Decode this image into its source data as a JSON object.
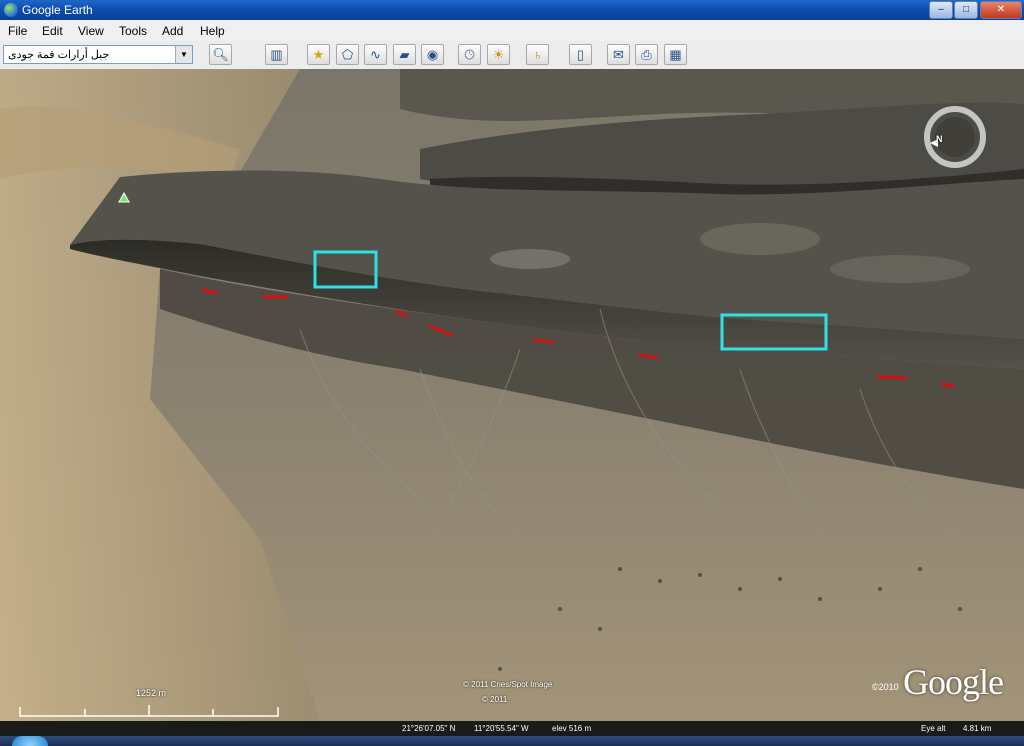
{
  "window": {
    "title": "Google Earth",
    "controls": {
      "minimize": "–",
      "maximize": "□",
      "close": "✕"
    }
  },
  "menu": [
    "File",
    "Edit",
    "View",
    "Tools",
    "Add",
    "Help"
  ],
  "search": {
    "value": "جبل أرارات قمة جودى"
  },
  "toolbar": {
    "buttons": [
      "search-icon",
      "sidebar-icon",
      "placemark-icon",
      "polygon-icon",
      "path-icon",
      "overlay-icon",
      "tour-icon",
      "history-icon",
      "sunlight-icon",
      "planet-icon",
      "ruler-icon",
      "email-icon",
      "print-icon",
      "maps-icon"
    ]
  },
  "map": {
    "attribution_1": "© 2011 Cnes/Spot Image",
    "attribution_2": "© 2011",
    "logo": "Google",
    "copyright": "©2010",
    "scale_label": "1252 m",
    "compass_label": "N"
  },
  "status": {
    "lat": "21°26'07.05\" N",
    "lon": "11°20'55.54\" W",
    "elev": "elev  516 m",
    "eye_label": "Eye alt",
    "eye_value": "4.81 km"
  },
  "colors": {
    "highlight_box": "#2fe0e6",
    "marker": "#d31010",
    "titlebar": "#0c4fb0"
  }
}
